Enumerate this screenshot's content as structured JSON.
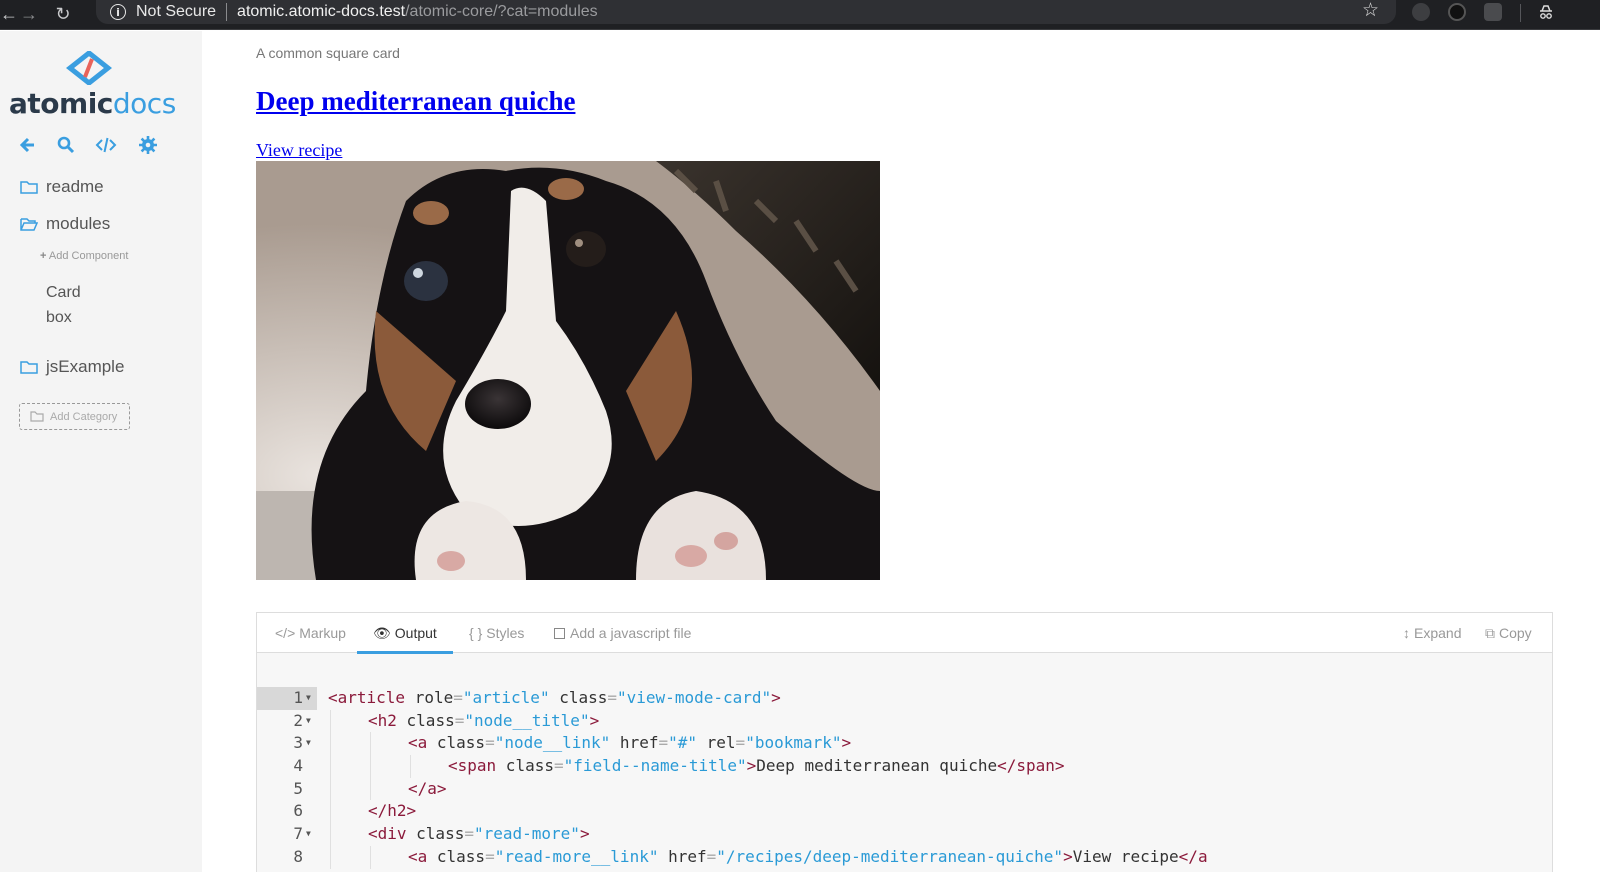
{
  "browser": {
    "security_label": "Not Secure",
    "url_host": "atomic.atomic-docs.test",
    "url_path": "/atomic-core/?cat=modules"
  },
  "sidebar": {
    "logo_primary": "atomic",
    "logo_secondary": "docs",
    "toolbar_icons": [
      "back-arrow-icon",
      "search-icon",
      "code-icon",
      "gear-icon"
    ],
    "categories": [
      {
        "label": "readme",
        "open": false
      },
      {
        "label": "modules",
        "open": true
      },
      {
        "label": "jsExample",
        "open": false
      }
    ],
    "add_component_label": "Add Component",
    "components": [
      "Card",
      "box"
    ],
    "add_category_label": "Add Category"
  },
  "main": {
    "subtitle": "A common square card",
    "card_title": "Deep mediterranean quiche",
    "view_link": "View recipe",
    "image_alt": "puppy photo"
  },
  "panel": {
    "tabs": [
      {
        "label": "Markup",
        "icon": "code-icon"
      },
      {
        "label": "Output",
        "icon": "eye-icon"
      },
      {
        "label": "Styles",
        "icon": "braces-icon"
      },
      {
        "label": "Add a javascript file",
        "icon": "checkbox-icon"
      }
    ],
    "active_tab": "Output",
    "expand_label": "Expand",
    "copy_label": "Copy",
    "code_lines": [
      {
        "n": "1",
        "fold": true
      },
      {
        "n": "2",
        "fold": true
      },
      {
        "n": "3",
        "fold": true
      },
      {
        "n": "4",
        "fold": false
      },
      {
        "n": "5",
        "fold": false
      },
      {
        "n": "6",
        "fold": false
      },
      {
        "n": "7",
        "fold": true
      },
      {
        "n": "8",
        "fold": false
      }
    ],
    "code_tokens": {
      "l1": [
        "<article",
        " role",
        "=",
        "\"article\"",
        " class",
        "=",
        "\"view-mode-card\"",
        ">"
      ],
      "l2": [
        "<h2",
        " class",
        "=",
        "\"node__title\"",
        ">"
      ],
      "l3": [
        "<a",
        " class",
        "=",
        "\"node__link\"",
        " href",
        "=",
        "\"#\"",
        " rel",
        "=",
        "\"bookmark\"",
        ">"
      ],
      "l4": [
        "<span",
        " class",
        "=",
        "\"field--name-title\"",
        ">",
        "Deep mediterranean quiche",
        "</span>"
      ],
      "l5": [
        "</a>"
      ],
      "l6": [
        "</h2>"
      ],
      "l7": [
        "<div",
        " class",
        "=",
        "\"read-more\"",
        ">"
      ],
      "l8": [
        "<a",
        " class",
        "=",
        "\"read-more__link\"",
        " href",
        "=",
        "\"/recipes/deep-mediterranean-quiche\"",
        ">",
        "View recipe",
        "</a"
      ]
    },
    "colors": {
      "tag": "#8b1a3b",
      "string": "#2a9ad6",
      "accent": "#3a9ee0"
    }
  }
}
